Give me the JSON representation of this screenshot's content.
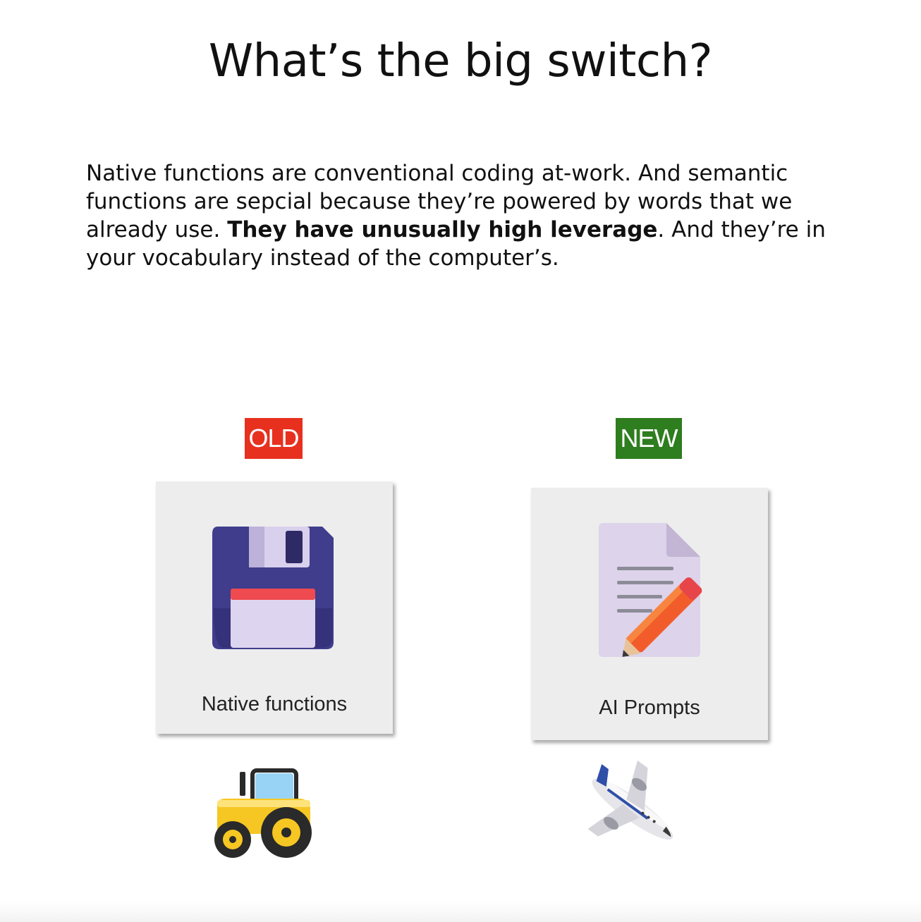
{
  "slide": {
    "title": "What’s the big switch?",
    "paragraph": {
      "part1": "Native functions are conventional coding at-work. And semantic functions are sepcial because they’re powered by words that we already use. ",
      "bold": "They have unusually high leverage",
      "part2": ". And they’re in your vocabulary instead of the computer’s."
    }
  },
  "comparison": {
    "old": {
      "tag": "OLD",
      "tag_color": "#e8301f",
      "label": "Native functions",
      "icon": "floppy-disk-icon",
      "emoji": "tractor-icon"
    },
    "new": {
      "tag": "NEW",
      "tag_color": "#2e7d1e",
      "label": "AI Prompts",
      "icon": "document-pencil-icon",
      "emoji": "airplane-icon"
    }
  }
}
